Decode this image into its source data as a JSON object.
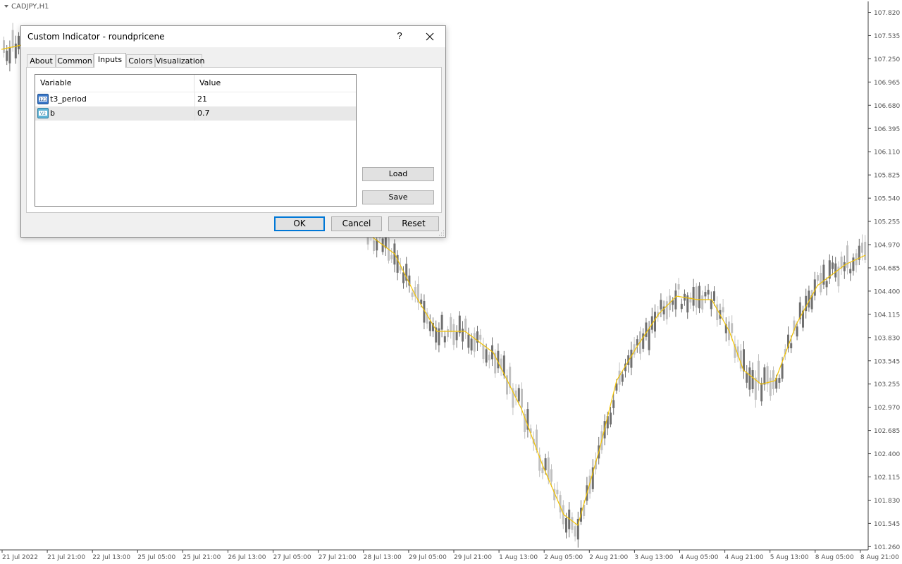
{
  "chart": {
    "symbol_label": "CADJPY,H1",
    "price_labels": [
      "107.820",
      "107.535",
      "107.250",
      "106.965",
      "106.680",
      "106.395",
      "106.110",
      "105.825",
      "105.540",
      "105.255",
      "104.970",
      "104.685",
      "104.400",
      "104.115",
      "103.830",
      "103.545",
      "103.255",
      "102.970",
      "102.685",
      "102.400",
      "102.115",
      "101.830",
      "101.545",
      "101.260"
    ],
    "time_labels": [
      "21 Jul 2022",
      "21 Jul 21:00",
      "22 Jul 13:00",
      "25 Jul 05:00",
      "25 Jul 21:00",
      "26 Jul 13:00",
      "27 Jul 05:00",
      "27 Jul 21:00",
      "28 Jul 13:00",
      "29 Jul 05:00",
      "29 Jul 21:00",
      "1 Aug 13:00",
      "2 Aug 05:00",
      "2 Aug 21:00",
      "3 Aug 13:00",
      "4 Aug 05:00",
      "4 Aug 21:00",
      "5 Aug 13:00",
      "8 Aug 05:00",
      "8 Aug 21:00"
    ],
    "indicator_color": "#f2c200",
    "bull_color": "#c0c0c0",
    "bear_color": "#707070",
    "grid_color": "#e6e6e6",
    "axis_color": "#404040"
  },
  "dialog": {
    "title": "Custom Indicator - roundpricene",
    "help_label": "?",
    "tabs": [
      {
        "label": "About"
      },
      {
        "label": "Common"
      },
      {
        "label": "Inputs"
      },
      {
        "label": "Colors"
      },
      {
        "label": "Visualization"
      }
    ],
    "active_tab": "Inputs",
    "table": {
      "headers": [
        "Variable",
        "Value"
      ],
      "rows": [
        {
          "icon": "integer-param-icon",
          "variable": "t3_period",
          "value": "21"
        },
        {
          "icon": "double-param-icon",
          "variable": "b",
          "value": "0.7"
        }
      ]
    },
    "load_label": "Load",
    "save_label": "Save",
    "ok_label": "OK",
    "cancel_label": "Cancel",
    "reset_label": "Reset"
  }
}
